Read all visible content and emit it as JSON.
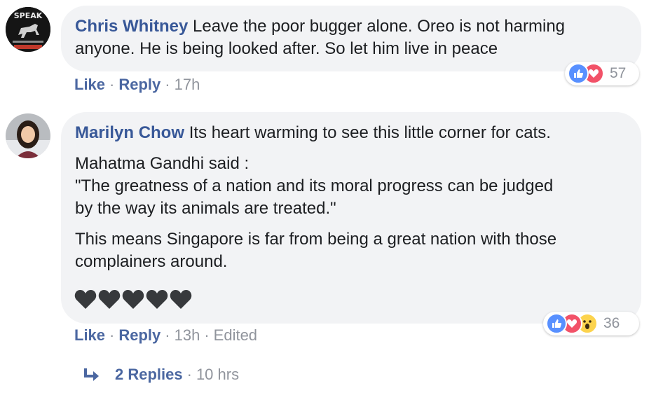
{
  "comments": [
    {
      "avatar_badge": "SPEAK",
      "author": "Chris Whitney",
      "text_lines": [
        "Leave the poor bugger alone. Oreo is not harming",
        "anyone. He is being looked after. So let him live in peace"
      ],
      "actions": {
        "like": "Like",
        "reply": "Reply",
        "time": "17h"
      },
      "reactions": {
        "icons": [
          "like-icon",
          "love-icon"
        ],
        "count": "57",
        "colors": {
          "like": "#5890ff",
          "love": "#f25268"
        }
      }
    },
    {
      "author": "Marilyn Chow",
      "first_line": "Its heart warming to see this little corner for cats.",
      "quote_intro": "Mahatma Gandhi said :",
      "quote_lines": [
        "\"The greatness of a nation and its moral progress can be judged",
        "by the way its animals are treated.\""
      ],
      "closing_lines": [
        "This means Singapore is far from being a great nation with those",
        "complainers around."
      ],
      "hearts": [
        "black-heart",
        "black-heart",
        "black-heart",
        "black-heart",
        "black-heart"
      ],
      "actions": {
        "like": "Like",
        "reply": "Reply",
        "time": "13h",
        "edited": "Edited"
      },
      "reactions": {
        "icons": [
          "like-icon",
          "love-icon",
          "wow-icon"
        ],
        "count": "36",
        "colors": {
          "like": "#5890ff",
          "love": "#f25268",
          "wow": "#fcd34d"
        }
      }
    }
  ],
  "replies": {
    "label": "2 Replies",
    "time": "10 hrs",
    "icon": "reply-arrow-icon"
  }
}
